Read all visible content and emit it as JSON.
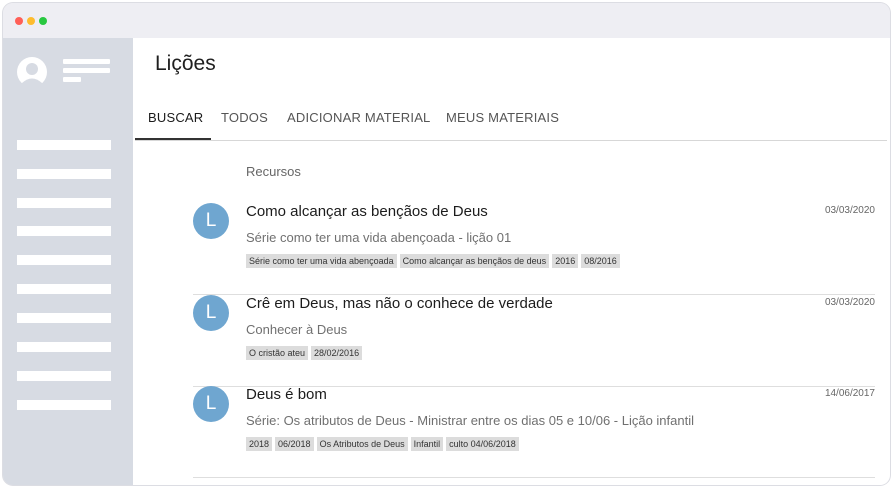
{
  "page": {
    "title": "Lições"
  },
  "tabs": [
    {
      "label": "BUSCAR"
    },
    {
      "label": "TODOS"
    },
    {
      "label": "ADICIONAR MATERIAL"
    },
    {
      "label": "MEUS MATERIAIS"
    }
  ],
  "section": {
    "label": "Recursos"
  },
  "items": [
    {
      "avatar": "L",
      "title": "Como alcançar as bençãos de Deus",
      "subtitle": "Série como ter uma vida abençoada - lição 01",
      "date": "03/03/2020",
      "tags": [
        "Série como ter uma vida abençoada",
        "Como alcançar as bençãos de deus",
        "2016",
        "08/2016"
      ]
    },
    {
      "avatar": "L",
      "title": "Crê em Deus, mas não o conhece de verdade",
      "subtitle": "Conhecer à Deus",
      "date": "03/03/2020",
      "tags": [
        "O cristão ateu",
        "28/02/2016"
      ]
    },
    {
      "avatar": "L",
      "title": "Deus é bom",
      "subtitle": "Série: Os atributos de Deus - Ministrar entre os dias 05 e 10/06 - Lição infantil",
      "date": "14/06/2017",
      "tags": [
        "2018",
        "06/2018",
        "Os Atributos de Deus",
        "Infantil",
        "culto 04/06/2018"
      ]
    }
  ],
  "colors": {
    "avatar": "#6fa6d0",
    "sidebar": "#d7dbe3",
    "accent": "#333333"
  },
  "icons": {
    "profile": "user-avatar-icon"
  }
}
